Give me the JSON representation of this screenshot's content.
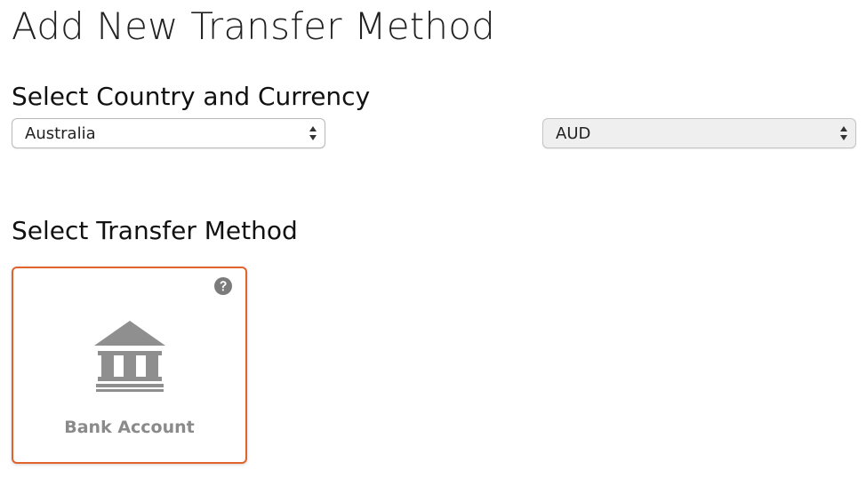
{
  "page": {
    "title": "Add New Transfer Method"
  },
  "country_currency": {
    "heading": "Select Country and Currency",
    "country_value": "Australia",
    "currency_value": "AUD"
  },
  "transfer_method": {
    "heading": "Select Transfer Method",
    "options": [
      {
        "label": "Bank Account",
        "icon": "bank-icon",
        "selected": true
      }
    ]
  },
  "colors": {
    "accent_border": "#e0642c",
    "icon_gray": "#8a8a8a"
  }
}
